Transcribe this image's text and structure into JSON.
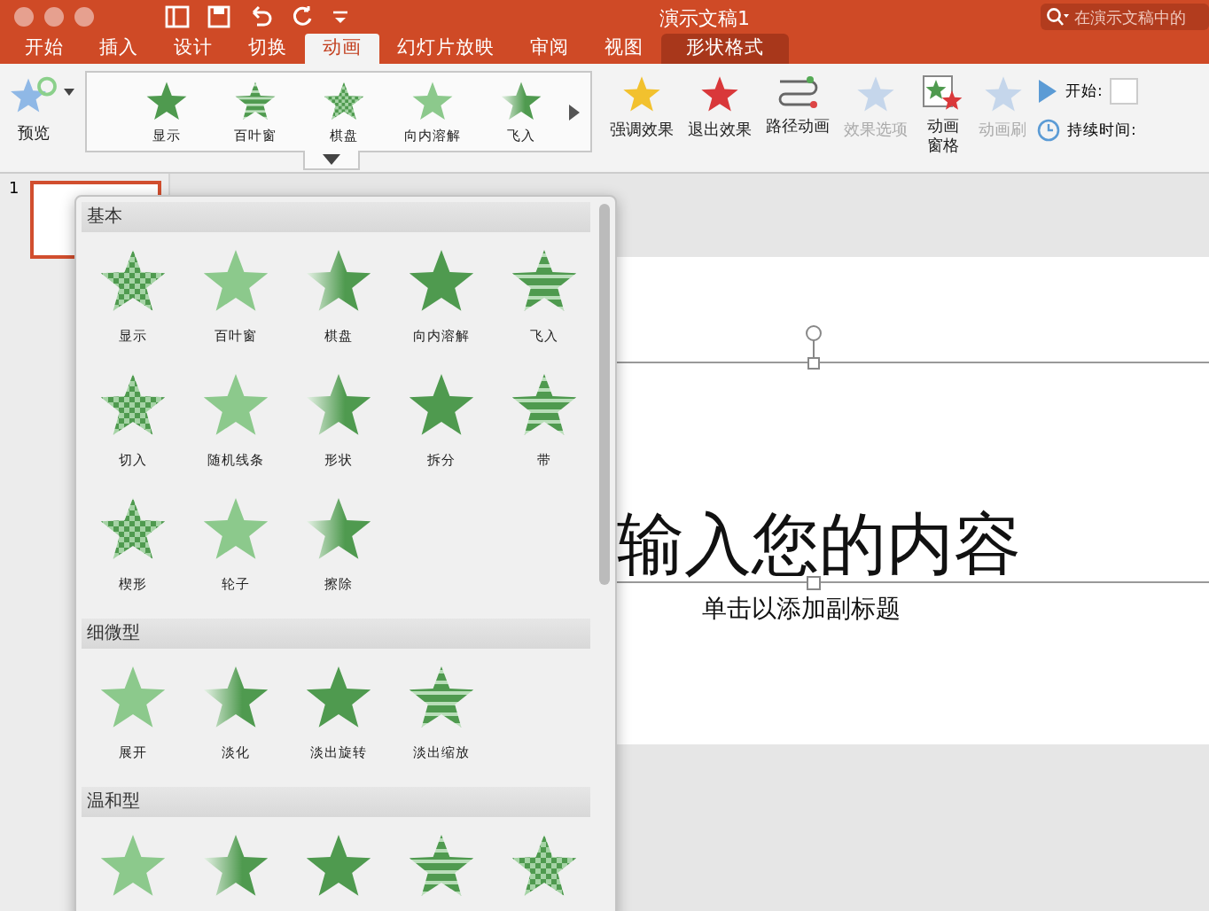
{
  "window": {
    "title": "演示文稿1",
    "search": {
      "placeholder": "在演示文稿中的"
    }
  },
  "tabs": [
    {
      "label": "开始",
      "selected": false,
      "kind": "normal"
    },
    {
      "label": "插入",
      "selected": false,
      "kind": "normal"
    },
    {
      "label": "设计",
      "selected": false,
      "kind": "normal"
    },
    {
      "label": "切换",
      "selected": false,
      "kind": "normal"
    },
    {
      "label": "动画",
      "selected": true,
      "kind": "normal"
    },
    {
      "label": "幻灯片放映",
      "selected": false,
      "kind": "normal"
    },
    {
      "label": "审阅",
      "selected": false,
      "kind": "normal"
    },
    {
      "label": "视图",
      "selected": false,
      "kind": "normal"
    },
    {
      "label": "形状格式",
      "selected": false,
      "kind": "contextual"
    }
  ],
  "ribbon": {
    "preview": {
      "label": "预览"
    },
    "gallery": [
      {
        "label": "显示"
      },
      {
        "label": "百叶窗"
      },
      {
        "label": "棋盘"
      },
      {
        "label": "向内溶解"
      },
      {
        "label": "飞入"
      }
    ],
    "buttons": [
      {
        "label": "强调效果",
        "kind": "emphasis",
        "disabled": false
      },
      {
        "label": "退出效果",
        "kind": "exit",
        "disabled": false
      },
      {
        "label": "路径动画",
        "kind": "path",
        "disabled": false
      },
      {
        "label": "效果选项",
        "kind": "options",
        "disabled": true
      },
      {
        "label": "动画窗格",
        "kind": "pane",
        "disabled": false
      },
      {
        "label": "动画刷",
        "kind": "painter",
        "disabled": true
      }
    ],
    "timing": [
      {
        "label": "开始:",
        "kind": "start"
      },
      {
        "label": "持续时间:",
        "kind": "duration"
      }
    ]
  },
  "thumbnails": [
    {
      "number": "1"
    }
  ],
  "animation_menu": {
    "sections": [
      {
        "title": "基本",
        "items": [
          {
            "kind": "effect",
            "label": "显示"
          },
          {
            "kind": "effect",
            "label": "百叶窗"
          },
          {
            "kind": "effect",
            "label": "棋盘"
          },
          {
            "kind": "effect",
            "label": "向内溶解"
          },
          {
            "kind": "effect",
            "label": "飞入"
          },
          {
            "kind": "effect",
            "label": "切入"
          },
          {
            "kind": "effect",
            "label": "随机线条"
          },
          {
            "kind": "effect",
            "label": "形状"
          },
          {
            "kind": "effect",
            "label": "拆分"
          },
          {
            "kind": "effect",
            "label": "带"
          },
          {
            "kind": "effect",
            "label": "楔形"
          },
          {
            "kind": "effect",
            "label": "轮子"
          },
          {
            "kind": "effect",
            "label": "擦除"
          }
        ]
      },
      {
        "title": "细微型",
        "items": [
          {
            "kind": "effect",
            "label": "展开"
          },
          {
            "kind": "effect",
            "label": "淡化"
          },
          {
            "kind": "effect",
            "label": "淡出旋转"
          },
          {
            "kind": "effect",
            "label": "淡出缩放"
          }
        ]
      },
      {
        "title": "温和型",
        "items": [
          {
            "kind": "effect"
          },
          {
            "kind": "effect"
          },
          {
            "kind": "effect"
          },
          {
            "kind": "effect"
          },
          {
            "kind": "effect"
          }
        ]
      }
    ]
  },
  "slide": {
    "title": "输入您的内容",
    "subtitle": "单击以添加副标题"
  }
}
